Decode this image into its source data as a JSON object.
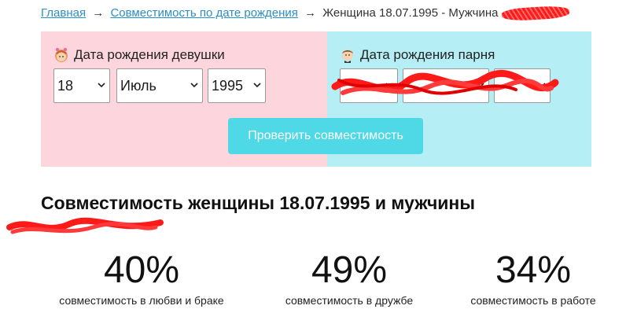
{
  "breadcrumb": {
    "home": "Главная",
    "section": "Совместимость по дате рождения",
    "current": "Женщина 18.07.1995 - Мужчина",
    "arrow": "→"
  },
  "girl": {
    "label": "Дата рождения девушки",
    "icon": "girl-face-icon",
    "day": "18",
    "month": "Июль",
    "year": "1995"
  },
  "boy": {
    "label": "Дата рождения парня",
    "icon": "boy-face-icon"
  },
  "check_button": "Проверить совместимость",
  "heading": "Совместимость женщины 18.07.1995 и мужчины",
  "stats": [
    {
      "value": "40%",
      "caption": "совместимость в любви и браке"
    },
    {
      "value": "49%",
      "caption": "совместимость в дружбе"
    },
    {
      "value": "34%",
      "caption": "совместимость в работе"
    }
  ],
  "colors": {
    "girl_bg": "#fdd6dd",
    "boy_bg": "#b5eef4",
    "button": "#4fd8e6",
    "link": "#2a8fc6",
    "redaction": "#ff1a1a"
  }
}
